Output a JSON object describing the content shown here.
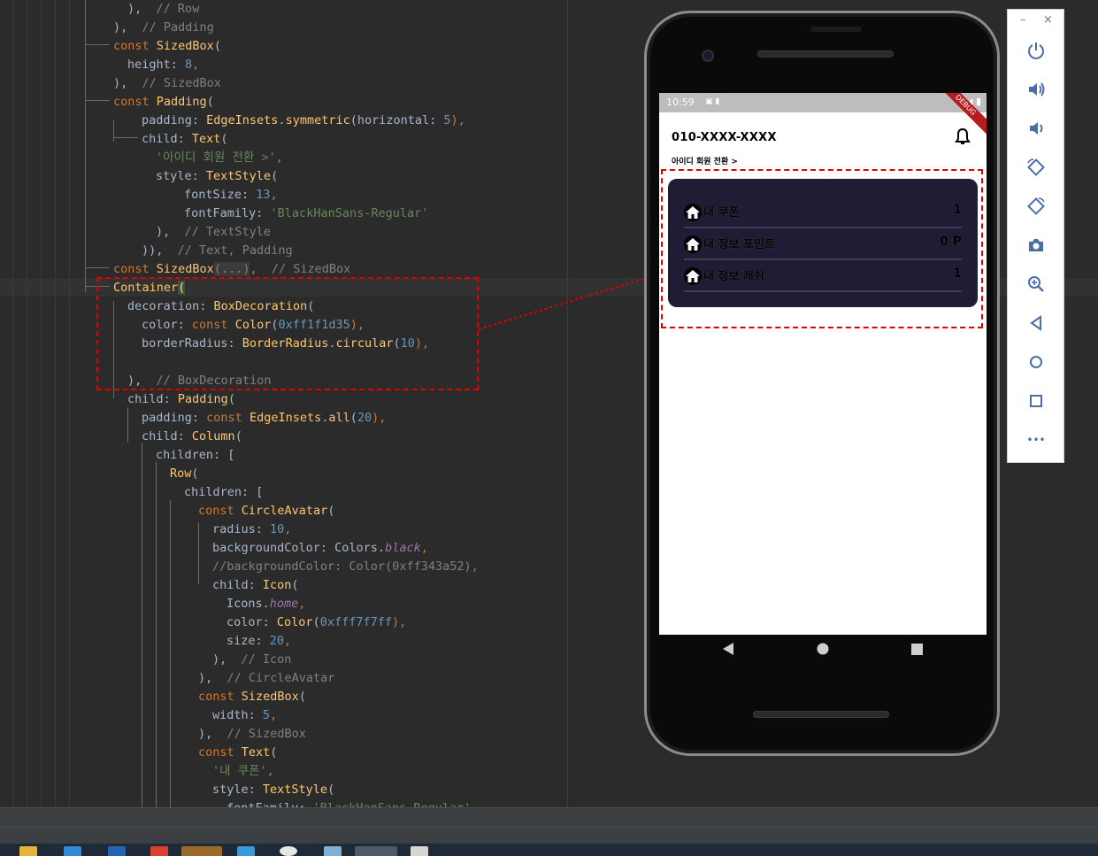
{
  "editor": {
    "lines": [
      [
        {
          "t": "),  "
        },
        {
          "t": "// Row",
          "c": "cmt"
        }
      ],
      [
        {
          "t": "),  "
        },
        {
          "t": "// Padding",
          "c": "cmt"
        }
      ],
      [
        {
          "t": "const ",
          "c": "kw"
        },
        {
          "t": "SizedBox",
          "c": "cls"
        },
        {
          "t": "("
        }
      ],
      [
        {
          "t": "height: "
        },
        {
          "t": "8",
          "c": "num"
        },
        {
          "t": ",",
          "c": "kw"
        }
      ],
      [
        {
          "t": "),  "
        },
        {
          "t": "// SizedBox",
          "c": "cmt"
        }
      ],
      [
        {
          "t": "const ",
          "c": "kw"
        },
        {
          "t": "Padding",
          "c": "cls"
        },
        {
          "t": "("
        }
      ],
      [
        {
          "t": "padding: "
        },
        {
          "t": "EdgeInsets",
          "c": "cls"
        },
        {
          "t": "."
        },
        {
          "t": "symmetric",
          "c": "cls"
        },
        {
          "t": "(horizontal: "
        },
        {
          "t": "5",
          "c": "num"
        },
        {
          "t": "),",
          "c": "kw"
        }
      ],
      [
        {
          "t": "child: "
        },
        {
          "t": "Text",
          "c": "cls"
        },
        {
          "t": "("
        }
      ],
      [
        {
          "t": "'아이디 회원 전환 >'",
          "c": "str"
        },
        {
          "t": ",",
          "c": "kw"
        }
      ],
      [
        {
          "t": "style: "
        },
        {
          "t": "TextStyle",
          "c": "cls"
        },
        {
          "t": "("
        }
      ],
      [
        {
          "t": "fontSize: "
        },
        {
          "t": "13",
          "c": "num"
        },
        {
          "t": ",",
          "c": "kw"
        }
      ],
      [
        {
          "t": "fontFamily: "
        },
        {
          "t": "'BlackHanSans-Regular'",
          "c": "str"
        }
      ],
      [
        {
          "t": "),  "
        },
        {
          "t": "// TextStyle",
          "c": "cmt"
        }
      ],
      [
        {
          "t": ")),  "
        },
        {
          "t": "// Text, Padding",
          "c": "cmt"
        }
      ],
      [
        {
          "t": "const ",
          "c": "kw"
        },
        {
          "t": "SizedBox",
          "c": "cls"
        },
        {
          "t": "(...)",
          "c": "fold"
        },
        {
          "t": ",  ",
          "c": "kw"
        },
        {
          "t": "// SizedBox",
          "c": "cmt"
        }
      ],
      [
        {
          "t": "Container",
          "c": "cls"
        },
        {
          "t": "(",
          "c": "hl-paren"
        }
      ],
      [
        {
          "t": "decoration: "
        },
        {
          "t": "BoxDecoration",
          "c": "cls"
        },
        {
          "t": "("
        }
      ],
      [
        {
          "t": "color: "
        },
        {
          "t": "const ",
          "c": "kw"
        },
        {
          "t": "Color",
          "c": "cls"
        },
        {
          "t": "("
        },
        {
          "t": "0xff1f1d35",
          "c": "num"
        },
        {
          "t": "),",
          "c": "kw"
        }
      ],
      [
        {
          "t": "borderRadius: "
        },
        {
          "t": "BorderRadius",
          "c": "cls"
        },
        {
          "t": "."
        },
        {
          "t": "circular",
          "c": "cls"
        },
        {
          "t": "("
        },
        {
          "t": "10",
          "c": "num"
        },
        {
          "t": "),",
          "c": "kw"
        }
      ],
      [],
      [
        {
          "t": "),  "
        },
        {
          "t": "// BoxDecoration",
          "c": "cmt"
        }
      ],
      [
        {
          "t": "child: "
        },
        {
          "t": "Padding",
          "c": "cls"
        },
        {
          "t": "("
        }
      ],
      [
        {
          "t": "padding: "
        },
        {
          "t": "const ",
          "c": "kw"
        },
        {
          "t": "EdgeInsets",
          "c": "cls"
        },
        {
          "t": "."
        },
        {
          "t": "all",
          "c": "cls"
        },
        {
          "t": "("
        },
        {
          "t": "20",
          "c": "num"
        },
        {
          "t": "),",
          "c": "kw"
        }
      ],
      [
        {
          "t": "child: "
        },
        {
          "t": "Column",
          "c": "cls"
        },
        {
          "t": "("
        }
      ],
      [
        {
          "t": "children: ["
        }
      ],
      [
        {
          "t": "Row",
          "c": "cls"
        },
        {
          "t": "("
        }
      ],
      [
        {
          "t": "children: ["
        }
      ],
      [
        {
          "t": "const ",
          "c": "kw"
        },
        {
          "t": "CircleAvatar",
          "c": "cls"
        },
        {
          "t": "("
        }
      ],
      [
        {
          "t": "radius: "
        },
        {
          "t": "10",
          "c": "num"
        },
        {
          "t": ",",
          "c": "kw"
        }
      ],
      [
        {
          "t": "backgroundColor: Colors."
        },
        {
          "t": "black",
          "c": "ital"
        },
        {
          "t": ",",
          "c": "kw"
        }
      ],
      [
        {
          "t": "//backgroundColor: Color(0xff343a52),",
          "c": "cmt"
        }
      ],
      [
        {
          "t": "child: "
        },
        {
          "t": "Icon",
          "c": "cls"
        },
        {
          "t": "("
        }
      ],
      [
        {
          "t": "Icons."
        },
        {
          "t": "home",
          "c": "ital"
        },
        {
          "t": ",",
          "c": "kw"
        }
      ],
      [
        {
          "t": "color: "
        },
        {
          "t": "Color",
          "c": "cls"
        },
        {
          "t": "("
        },
        {
          "t": "0xfff7f7ff",
          "c": "num"
        },
        {
          "t": "),",
          "c": "kw"
        }
      ],
      [
        {
          "t": "size: "
        },
        {
          "t": "20",
          "c": "num"
        },
        {
          "t": ",",
          "c": "kw"
        }
      ],
      [
        {
          "t": "),  "
        },
        {
          "t": "// Icon",
          "c": "cmt"
        }
      ],
      [
        {
          "t": "),  "
        },
        {
          "t": "// CircleAvatar",
          "c": "cmt"
        }
      ],
      [
        {
          "t": "const ",
          "c": "kw"
        },
        {
          "t": "SizedBox",
          "c": "cls"
        },
        {
          "t": "("
        }
      ],
      [
        {
          "t": "width: "
        },
        {
          "t": "5",
          "c": "num"
        },
        {
          "t": ",",
          "c": "kw"
        }
      ],
      [
        {
          "t": "),  "
        },
        {
          "t": "// SizedBox",
          "c": "cmt"
        }
      ],
      [
        {
          "t": "const ",
          "c": "kw"
        },
        {
          "t": "Text",
          "c": "cls"
        },
        {
          "t": "("
        }
      ],
      [
        {
          "t": "'내 쿠폰'",
          "c": "str"
        },
        {
          "t": ",",
          "c": "kw"
        }
      ],
      [
        {
          "t": "style: "
        },
        {
          "t": "TextStyle",
          "c": "cls"
        },
        {
          "t": "("
        }
      ],
      [
        {
          "t": "fontFamily: "
        },
        {
          "t": "'BlackHanSans-Regular'",
          "c": "str"
        }
      ]
    ]
  },
  "app": {
    "status_time": "10:59",
    "debug_badge": "DEBUG",
    "phone_number": "010-XXXX-XXXX",
    "id_switch_label": "아이디 회원 전환 >",
    "card_color": "#1f1d35",
    "rows": [
      {
        "label": "내 쿠폰",
        "value": "1"
      },
      {
        "label": "내 정보 포인트",
        "value": "0 P"
      },
      {
        "label": "내 정보 캐쉬",
        "value": "1"
      }
    ]
  },
  "emulator_toolbar": {
    "minimize": "–",
    "close": "×",
    "buttons": [
      "power-icon",
      "volume-up-icon",
      "volume-down-icon",
      "rotate-left-icon",
      "rotate-right-icon",
      "camera-icon",
      "zoom-icon",
      "back-icon",
      "home-icon",
      "overview-icon",
      "more-icon"
    ],
    "more_label": "•••"
  },
  "colors": {
    "editor_bg": "#2b2b2b",
    "annotation": "#e00000",
    "toolbar_icon": "#4a6fa5"
  }
}
